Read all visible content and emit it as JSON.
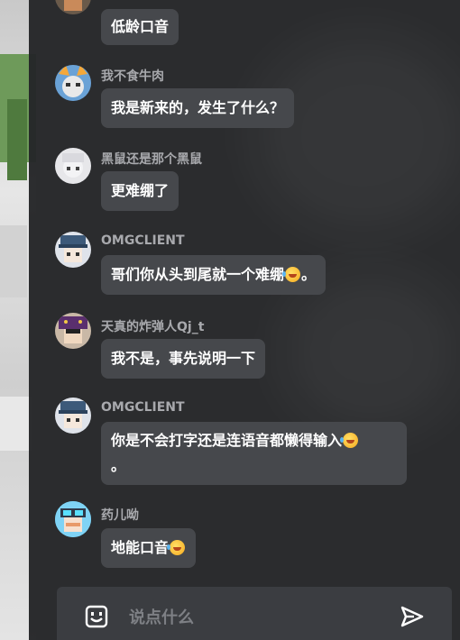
{
  "colors": {
    "panel_bg": "#252628",
    "bubble_bg": "#46484c",
    "sender_name": "#a8a9ad",
    "message_text": "#ffffff",
    "input_bg": "#3b3d41"
  },
  "messages": [
    {
      "sender": "",
      "text": "低龄口音",
      "avatar_icon": "player-avatar-icon"
    },
    {
      "sender": "我不食牛肉",
      "text": "我是新来的，发生了什么？",
      "avatar_icon": "cat-ear-avatar-icon"
    },
    {
      "sender": "黑鼠还是那个黑鼠",
      "text": "更难绷了",
      "avatar_icon": "white-hair-avatar-icon"
    },
    {
      "sender": "OMGCLIENT",
      "text": "哥们你从头到尾就一个难绷",
      "text_suffix": "。",
      "emoji": "rolling-laughing-emoji",
      "avatar_icon": "cap-avatar-icon"
    },
    {
      "sender": "天真的炸弹人Qj_t",
      "text": "我不是，事先说明一下",
      "avatar_icon": "purple-hat-avatar-icon"
    },
    {
      "sender": "OMGCLIENT",
      "text": "你是不会打字还是连语音都懒得输入",
      "text_line2": "。",
      "emoji": "rolling-laughing-emoji",
      "avatar_icon": "cap-avatar-icon"
    },
    {
      "sender": "药儿呦",
      "text": "地能口音",
      "emoji": "rolling-laughing-emoji",
      "avatar_icon": "goggles-avatar-icon"
    }
  ],
  "input": {
    "placeholder": "说点什么",
    "value": "",
    "emoji_button_icon": "emoji-face-icon",
    "send_button_icon": "send-icon"
  }
}
